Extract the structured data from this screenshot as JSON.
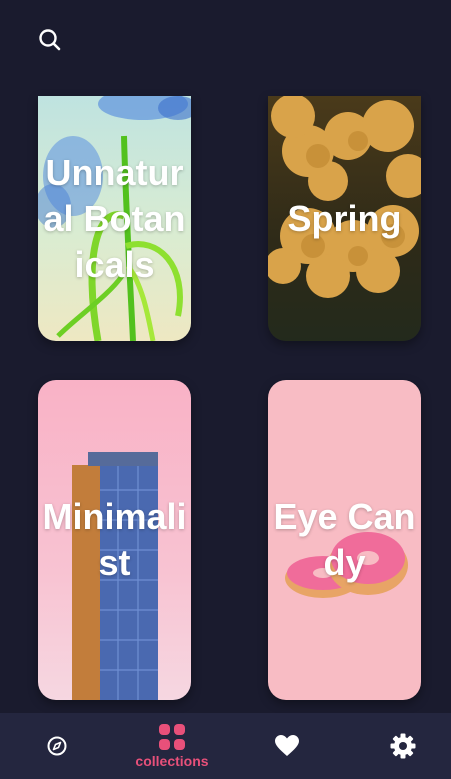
{
  "header": {
    "search_icon": "search-icon"
  },
  "collections": [
    {
      "title": "Unnatural Botanicals"
    },
    {
      "title": "Spring"
    },
    {
      "title": "Minimalist"
    },
    {
      "title": "Eye Candy"
    }
  ],
  "bottom_nav": {
    "items": [
      {
        "icon": "explore-icon",
        "label": ""
      },
      {
        "icon": "collections-icon",
        "label": "collections",
        "active": true
      },
      {
        "icon": "heart-icon",
        "label": ""
      },
      {
        "icon": "gear-icon",
        "label": ""
      }
    ]
  },
  "colors": {
    "background": "#1a1b2e",
    "nav_background": "#24263f",
    "accent": "#e8507a"
  }
}
